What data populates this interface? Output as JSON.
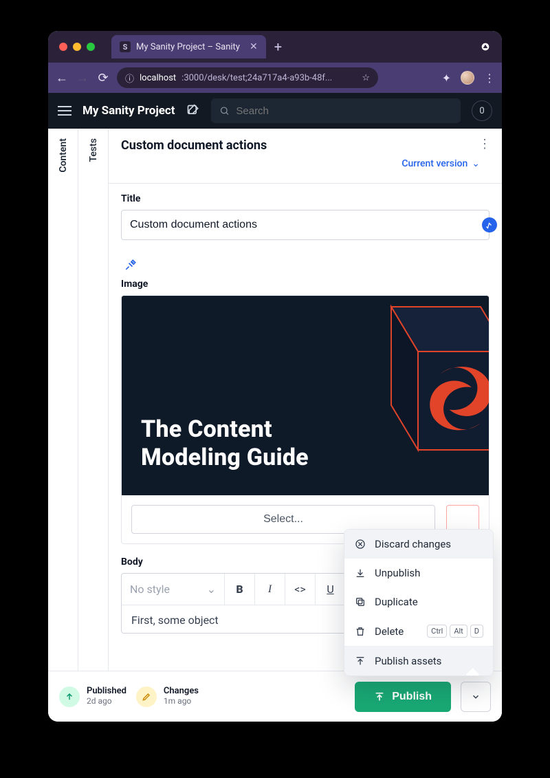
{
  "browser": {
    "tab_title": "My Sanity Project – Sanity",
    "favicon_letter": "S",
    "url_host": "localhost",
    "url_rest": ":3000/desk/test;24a717a4-a93b-48f..."
  },
  "app": {
    "title": "My Sanity Project",
    "search_placeholder": "Search",
    "counter": "0"
  },
  "rails": {
    "content": "Content",
    "tests": "Tests"
  },
  "doc": {
    "title": "Custom document actions",
    "version_label": "Current version",
    "fields": {
      "title_label": "Title",
      "title_value": "Custom document actions",
      "image_label": "Image",
      "hero_line1": "The Content",
      "hero_line2": "Modeling Guide",
      "select_label": "Select...",
      "body_label": "Body",
      "style_placeholder": "No style",
      "body_content": "First, some object"
    }
  },
  "menu": {
    "discard": "Discard changes",
    "unpublish": "Unpublish",
    "duplicate": "Duplicate",
    "delete": "Delete",
    "delete_keys": [
      "Ctrl",
      "Alt",
      "D"
    ],
    "publish_assets": "Publish assets"
  },
  "footer": {
    "published_label": "Published",
    "published_time": "2d ago",
    "changes_label": "Changes",
    "changes_time": "1m ago",
    "publish_button": "Publish"
  }
}
